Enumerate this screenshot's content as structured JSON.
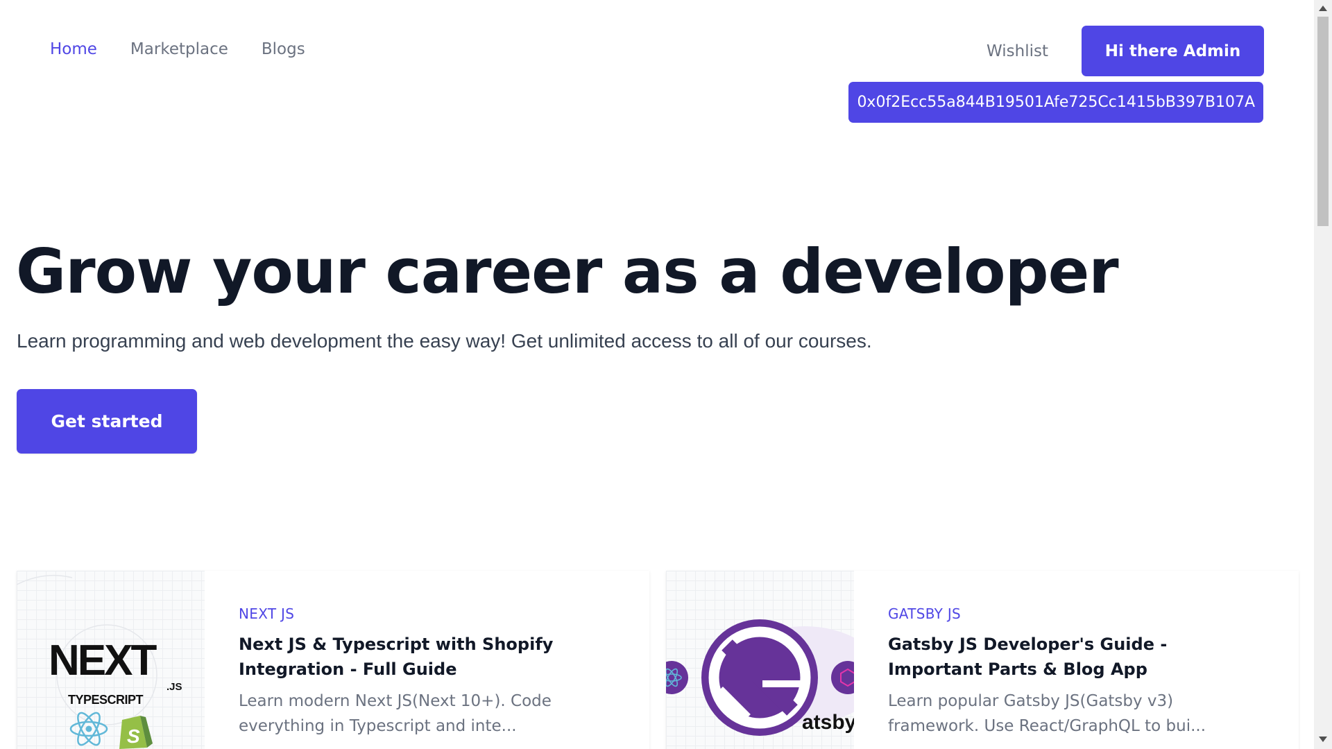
{
  "nav": {
    "links": [
      {
        "label": "Home",
        "active": true
      },
      {
        "label": "Marketplace",
        "active": false
      },
      {
        "label": "Blogs",
        "active": false
      }
    ],
    "wishlist": "Wishlist",
    "account_button": "Hi there Admin",
    "wallet_address": "0x0f2Ecc55a844B19501Afe725Cc1415bB397B107A"
  },
  "hero": {
    "title": "Grow your career as a developer",
    "subtitle": "Learn programming and web development the easy way! Get unlimited access to all of our courses.",
    "cta": "Get started"
  },
  "courses": [
    {
      "category": "NEXT JS",
      "title": "Next JS & Typescript with Shopify Integration - Full Guide",
      "description": "Learn modern Next JS(Next 10+). Code everything in Typescript and inte...",
      "thumbnail_text": {
        "brand": "NEXT",
        "suffix": ".JS",
        "sub": "TYPESCRIPT"
      },
      "thumbnail_icons": [
        "react-icon",
        "shopify-icon"
      ]
    },
    {
      "category": "GATSBY JS",
      "title": "Gatsby JS Developer's Guide - Important Parts & Blog App",
      "description": "Learn popular Gatsby JS(Gatsby v3) framework. Use React/GraphQL to bui...",
      "thumbnail_text": {
        "brand": "atsby"
      },
      "thumbnail_icons": [
        "gatsby-icon",
        "react-icon",
        "graphql-icon"
      ]
    }
  ],
  "colors": {
    "accent": "#4f46e5",
    "heading": "#111827",
    "muted": "#6b7280",
    "gatsby_purple": "#663399"
  }
}
